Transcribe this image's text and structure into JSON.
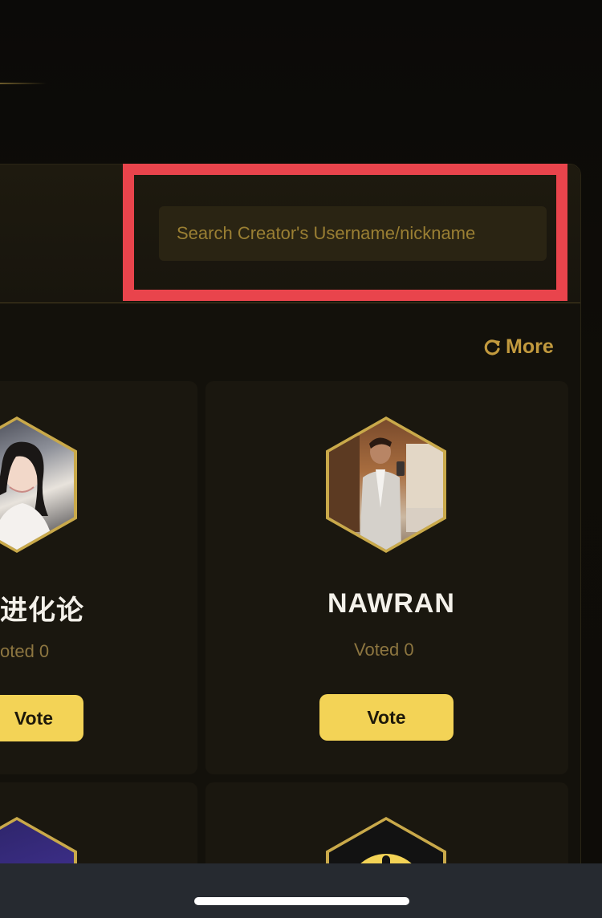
{
  "search": {
    "placeholder": "Search Creator's Username/nickname"
  },
  "more": {
    "label": "More",
    "icon": "refresh-icon"
  },
  "creators": [
    {
      "name": "进化论",
      "voted_label": "oted 0",
      "vote_label": "Vote"
    },
    {
      "name": "NAWRAN",
      "voted_label": "Voted 0",
      "vote_label": "Vote"
    }
  ],
  "colors": {
    "accent": "#f3d356",
    "highlight": "#e9444c",
    "gold": "#c29a3e"
  }
}
